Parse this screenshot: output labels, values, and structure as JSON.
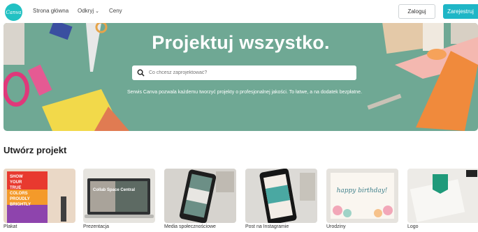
{
  "header": {
    "logo_text": "Canva",
    "nav": [
      {
        "label": "Strona główna"
      },
      {
        "label": "Odkryj"
      },
      {
        "label": "Ceny"
      }
    ],
    "login_label": "Zaloguj",
    "signup_label": "Zarejestruj"
  },
  "hero": {
    "title": "Projektuj wszystko.",
    "search_placeholder": "Co chcesz zaprojektować?",
    "subtitle": "Serwis Canva pozwala każdemu tworzyć projekty o profesjonalnej jakości. To łatwe, a na dodatek bezpłatne."
  },
  "create": {
    "title": "Utwórz projekt",
    "cards": [
      {
        "label": "Plakat"
      },
      {
        "label": "Prezentacja"
      },
      {
        "label": "Media społecznościowe"
      },
      {
        "label": "Post na Instagramie"
      },
      {
        "label": "Urodziny"
      },
      {
        "label": "Logo"
      }
    ],
    "thumb_text": {
      "poster": [
        "SHOW",
        "YOUR",
        "TRUE",
        "COLORS",
        "PROUDLY",
        "BRIGHTLY"
      ],
      "presentation": "Collab Space Central",
      "birthday": "happy birthday!"
    }
  },
  "colors": {
    "brand": "#22c1c3",
    "signup": "#1fb6c6",
    "hero_bg": "#6fa894"
  },
  "icons": {
    "search": "search-icon",
    "chevron": "chevron-down-icon"
  }
}
